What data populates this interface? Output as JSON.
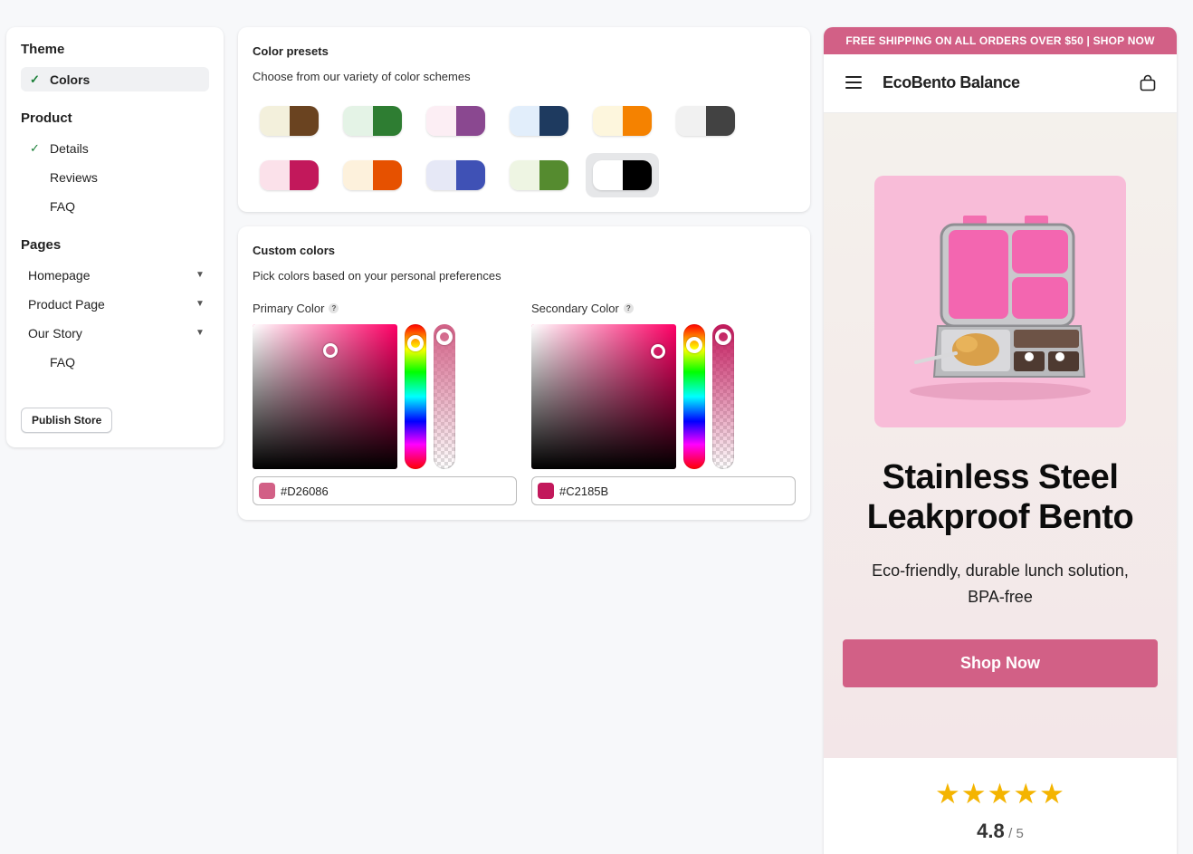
{
  "sidebar": {
    "theme_title": "Theme",
    "theme_items": [
      {
        "label": "Colors",
        "check": "✓"
      }
    ],
    "product_title": "Product",
    "product_items": [
      {
        "label": "Details",
        "check": "✓"
      },
      {
        "label": "Reviews"
      },
      {
        "label": "FAQ"
      }
    ],
    "pages_title": "Pages",
    "pages_items": [
      {
        "label": "Homepage"
      },
      {
        "label": "Product Page"
      },
      {
        "label": "Our Story"
      }
    ],
    "pages_sub": [
      {
        "label": "FAQ"
      }
    ],
    "publish_label": "Publish Store"
  },
  "presets": {
    "title": "Color presets",
    "subtitle": "Choose from our variety of color schemes",
    "selected_index": 10,
    "swatches": [
      {
        "left": "#f3f0dc",
        "right": "#6a4320"
      },
      {
        "left": "#e4f3e6",
        "right": "#2e7d32"
      },
      {
        "left": "#fceef4",
        "right": "#8a4890"
      },
      {
        "left": "#e2eefb",
        "right": "#1e3a5f"
      },
      {
        "left": "#fdf6dd",
        "right": "#f58200"
      },
      {
        "left": "#f1f1f1",
        "right": "#424242"
      },
      {
        "left": "#fbe1ea",
        "right": "#c2185b"
      },
      {
        "left": "#fdf1dc",
        "right": "#e65100"
      },
      {
        "left": "#e6e8f6",
        "right": "#3f51b5"
      },
      {
        "left": "#eef5e3",
        "right": "#558b2f"
      },
      {
        "left": "#ffffff",
        "right": "#000000"
      }
    ]
  },
  "custom": {
    "title": "Custom colors",
    "subtitle": "Pick colors based on your personal preferences",
    "primary": {
      "label": "Primary Color",
      "help": "?",
      "hex": "#D26086",
      "hue_color": "#ff0066",
      "swatch": "#d26086"
    },
    "secondary": {
      "label": "Secondary Color",
      "help": "?",
      "hex": "#C2185B",
      "hue_color": "#ff0066",
      "swatch": "#c2185b"
    }
  },
  "preview": {
    "banner": "FREE SHIPPING ON ALL ORDERS OVER $50 | SHOP NOW",
    "brand": "EcoBento Balance",
    "hero_title_line1": "Stainless Steel",
    "hero_title_line2": "Leakproof Bento",
    "hero_subtitle": "Eco-friendly, durable lunch solution, BPA-free",
    "cta": "Shop Now",
    "stars": "★★★★★",
    "rating": "4.8",
    "rating_max": "/ 5"
  }
}
